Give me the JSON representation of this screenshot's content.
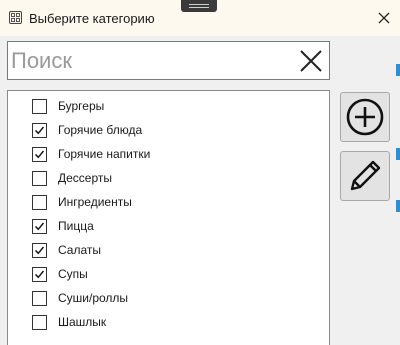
{
  "window": {
    "title": "Выберите категорию",
    "icons": {
      "app": "app-grid-icon",
      "close": "close-icon"
    }
  },
  "search": {
    "placeholder": "Поиск",
    "value": "",
    "clear_icon": "clear-x-icon"
  },
  "categories": [
    {
      "label": "Бургеры",
      "checked": false
    },
    {
      "label": "Горячие блюда",
      "checked": true
    },
    {
      "label": "Горячие напитки",
      "checked": true
    },
    {
      "label": "Дессерты",
      "checked": false
    },
    {
      "label": "Ингредиенты",
      "checked": false
    },
    {
      "label": "Пицца",
      "checked": true
    },
    {
      "label": "Салаты",
      "checked": true
    },
    {
      "label": "Супы",
      "checked": true
    },
    {
      "label": "Суши/роллы",
      "checked": false
    },
    {
      "label": "Шашлык",
      "checked": false
    }
  ],
  "toolbar": {
    "add_icon": "add-circle-icon",
    "edit_icon": "pencil-edit-icon"
  },
  "colors": {
    "titlebar_bg": "#fdf9ef",
    "window_bg": "#f0f0f0",
    "accent": "#2a8fd6"
  }
}
